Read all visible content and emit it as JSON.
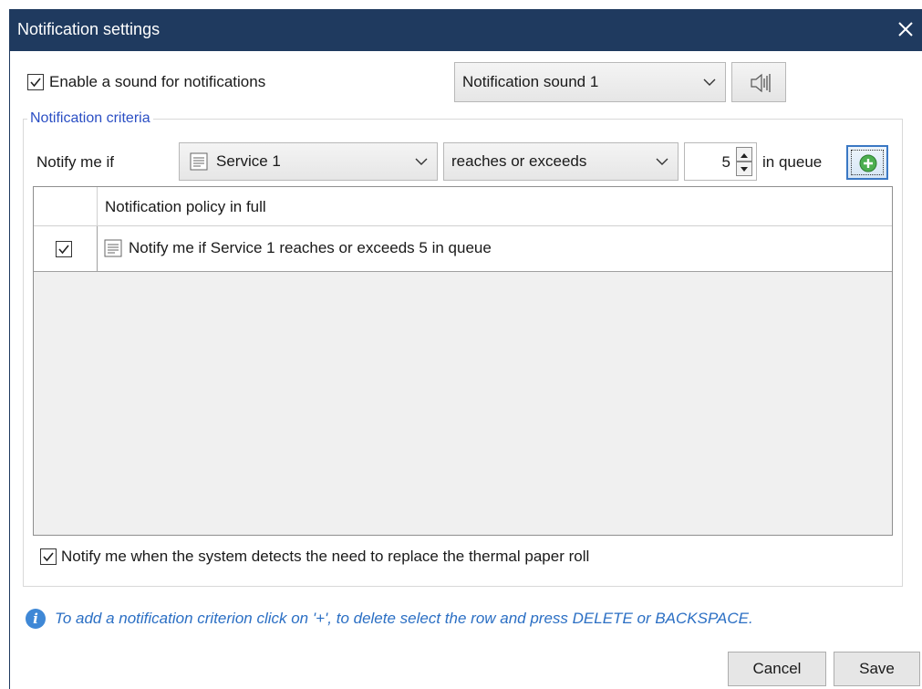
{
  "window": {
    "title": "Notification settings"
  },
  "sound": {
    "enable_label": "Enable a sound for notifications",
    "enabled": true,
    "selected_sound": "Notification sound 1"
  },
  "criteria": {
    "group_title": "Notification criteria",
    "notify_label": "Notify me if",
    "service_value": "Service 1",
    "operator_value": "reaches or exceeds",
    "threshold_value": "5",
    "unit_label": "in queue"
  },
  "table": {
    "header": "Notification policy in full",
    "rows": [
      {
        "checked": true,
        "text": "Notify me if Service 1 reaches or exceeds 5 in queue"
      }
    ]
  },
  "paper": {
    "label": "Notify me when the system detects the need to replace the thermal paper roll",
    "checked": true
  },
  "info_text": "To add a notification criterion click on '+', to delete select the row and press DELETE or BACKSPACE.",
  "buttons": {
    "cancel": "Cancel",
    "save": "Save"
  },
  "colors": {
    "titlebar": "#1f3a5f",
    "group_title": "#2b4fc4",
    "info_text": "#2b6fc4",
    "add_button": "#4caf50"
  },
  "icons": [
    "close-icon",
    "checkbox-checked-icon",
    "chevron-down-icon",
    "speaker-icon",
    "service-ticket-icon",
    "spin-up-icon",
    "spin-down-icon",
    "add-plus-icon",
    "info-icon"
  ]
}
